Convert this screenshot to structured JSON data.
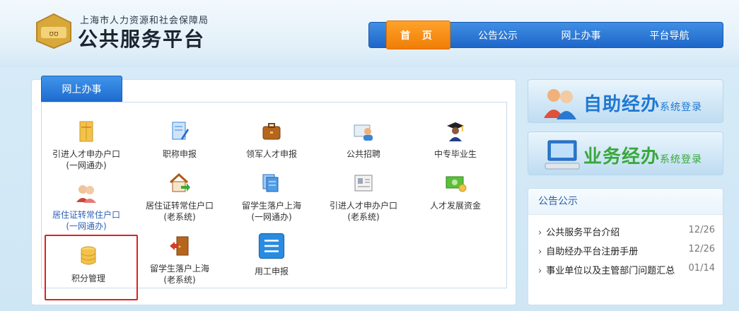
{
  "header": {
    "org_name": "上海市人力资源和社会保障局",
    "platform_name": "公共服务平台"
  },
  "nav": {
    "items": [
      {
        "label": "首 页",
        "active": true
      },
      {
        "label": "公告公示",
        "active": false
      },
      {
        "label": "网上办事",
        "active": false
      },
      {
        "label": "平台导航",
        "active": false
      }
    ]
  },
  "services": {
    "tab_label": "网上办事",
    "tiles": [
      {
        "line1": "引进人才申办户口",
        "line2": "(一网通办)",
        "icon": "envelope-icon"
      },
      {
        "line1": "职称申报",
        "line2": "",
        "icon": "certificate-edit-icon"
      },
      {
        "line1": "领军人才申报",
        "line2": "",
        "icon": "briefcase-icon"
      },
      {
        "line1": "公共招聘",
        "line2": "",
        "icon": "id-card-person-icon"
      },
      {
        "line1": "中专毕业生",
        "line2": "",
        "icon": "graduate-icon"
      },
      {
        "line1": "居住证转常住户口",
        "line2": "(一网通办)",
        "icon": "two-people-icon"
      },
      {
        "line1": "居住证转常住户口",
        "line2": "(老系统)",
        "icon": "house-arrow-icon"
      },
      {
        "line1": "留学生落户上海",
        "line2": "(一网通办)",
        "icon": "documents-stack-icon"
      },
      {
        "line1": "引进人才申办户口",
        "line2": "(老系统)",
        "icon": "id-card-icon"
      },
      {
        "line1": "人才发展资金",
        "line2": "",
        "icon": "money-icon"
      },
      {
        "line1": "积分管理",
        "line2": "",
        "icon": "database-icon"
      },
      {
        "line1": "留学生落户上海",
        "line2": "(老系统)",
        "icon": "door-exit-icon"
      },
      {
        "line1": "用工申报",
        "line2": "",
        "icon": "list-document-icon"
      }
    ]
  },
  "login": {
    "self_service": {
      "big": "自助经办",
      "small": "系统登录"
    },
    "business": {
      "big": "业务经办",
      "small": "系统登录"
    }
  },
  "notice": {
    "title": "公告公示",
    "items": [
      {
        "text": "公共服务平台介绍",
        "date": "12/26"
      },
      {
        "text": "自助经办平台注册手册",
        "date": "12/26"
      },
      {
        "text": "事业单位以及主管部门问题汇总",
        "date": "01/14"
      }
    ]
  }
}
